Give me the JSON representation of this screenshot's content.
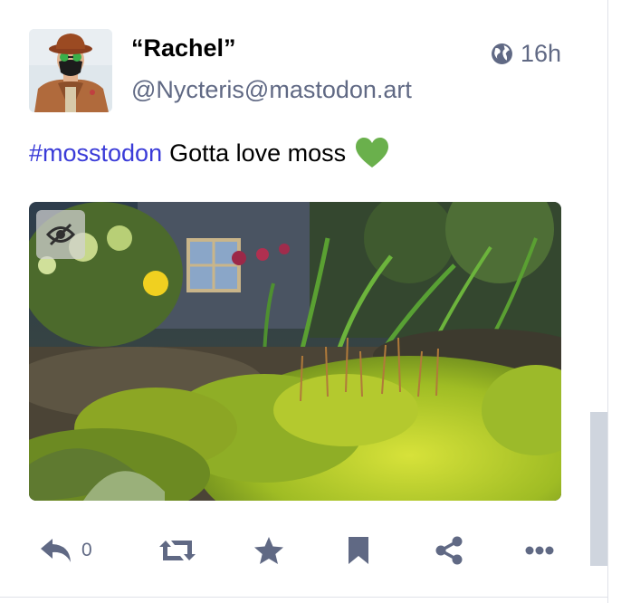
{
  "status": {
    "author": {
      "display_name": "“Rachel”",
      "handle": "@Nycteris@mastodon.art",
      "avatar_icon": "avatar-photo"
    },
    "visibility_icon": "globe-icon",
    "timestamp": "16h",
    "content": {
      "hashtag": "#mosstodon",
      "text": "Gotta love moss",
      "emoji": "green-heart"
    },
    "media": {
      "type": "photo",
      "hide_icon": "eye-slash-icon"
    },
    "actions": {
      "reply_count": "0",
      "icons": [
        "reply-icon",
        "boost-icon",
        "star-icon",
        "bookmark-icon",
        "share-icon",
        "ellipsis-icon"
      ]
    }
  },
  "colors": {
    "hashtag": "#3a3bd8",
    "muted": "#606984",
    "text": "#000000",
    "heart": "#6ab04c"
  }
}
